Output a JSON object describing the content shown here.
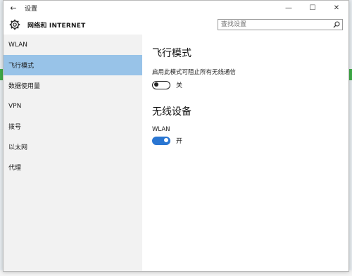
{
  "window": {
    "title": "设置",
    "controls": {
      "minimize": "—",
      "maximize": "☐",
      "close": "✕"
    }
  },
  "header": {
    "title": "网络和 INTERNET",
    "search_placeholder": "查找设置"
  },
  "sidebar": {
    "items": [
      {
        "label": "WLAN"
      },
      {
        "label": "飞行模式"
      },
      {
        "label": "数据使用量"
      },
      {
        "label": "VPN"
      },
      {
        "label": "拨号"
      },
      {
        "label": "以太网"
      },
      {
        "label": "代理"
      }
    ],
    "active_index": 1
  },
  "main": {
    "airplane": {
      "title": "飞行模式",
      "description": "启用此模式可阻止所有无线通信",
      "toggle_state": "off",
      "toggle_label": "关"
    },
    "wireless": {
      "title": "无线设备",
      "wlan_label": "WLAN",
      "toggle_state": "on",
      "toggle_label": "开"
    }
  },
  "colors": {
    "accent": "#2a76d2",
    "nav_selected": "#98c3e8",
    "sidebar_bg": "#f2f2f2"
  }
}
